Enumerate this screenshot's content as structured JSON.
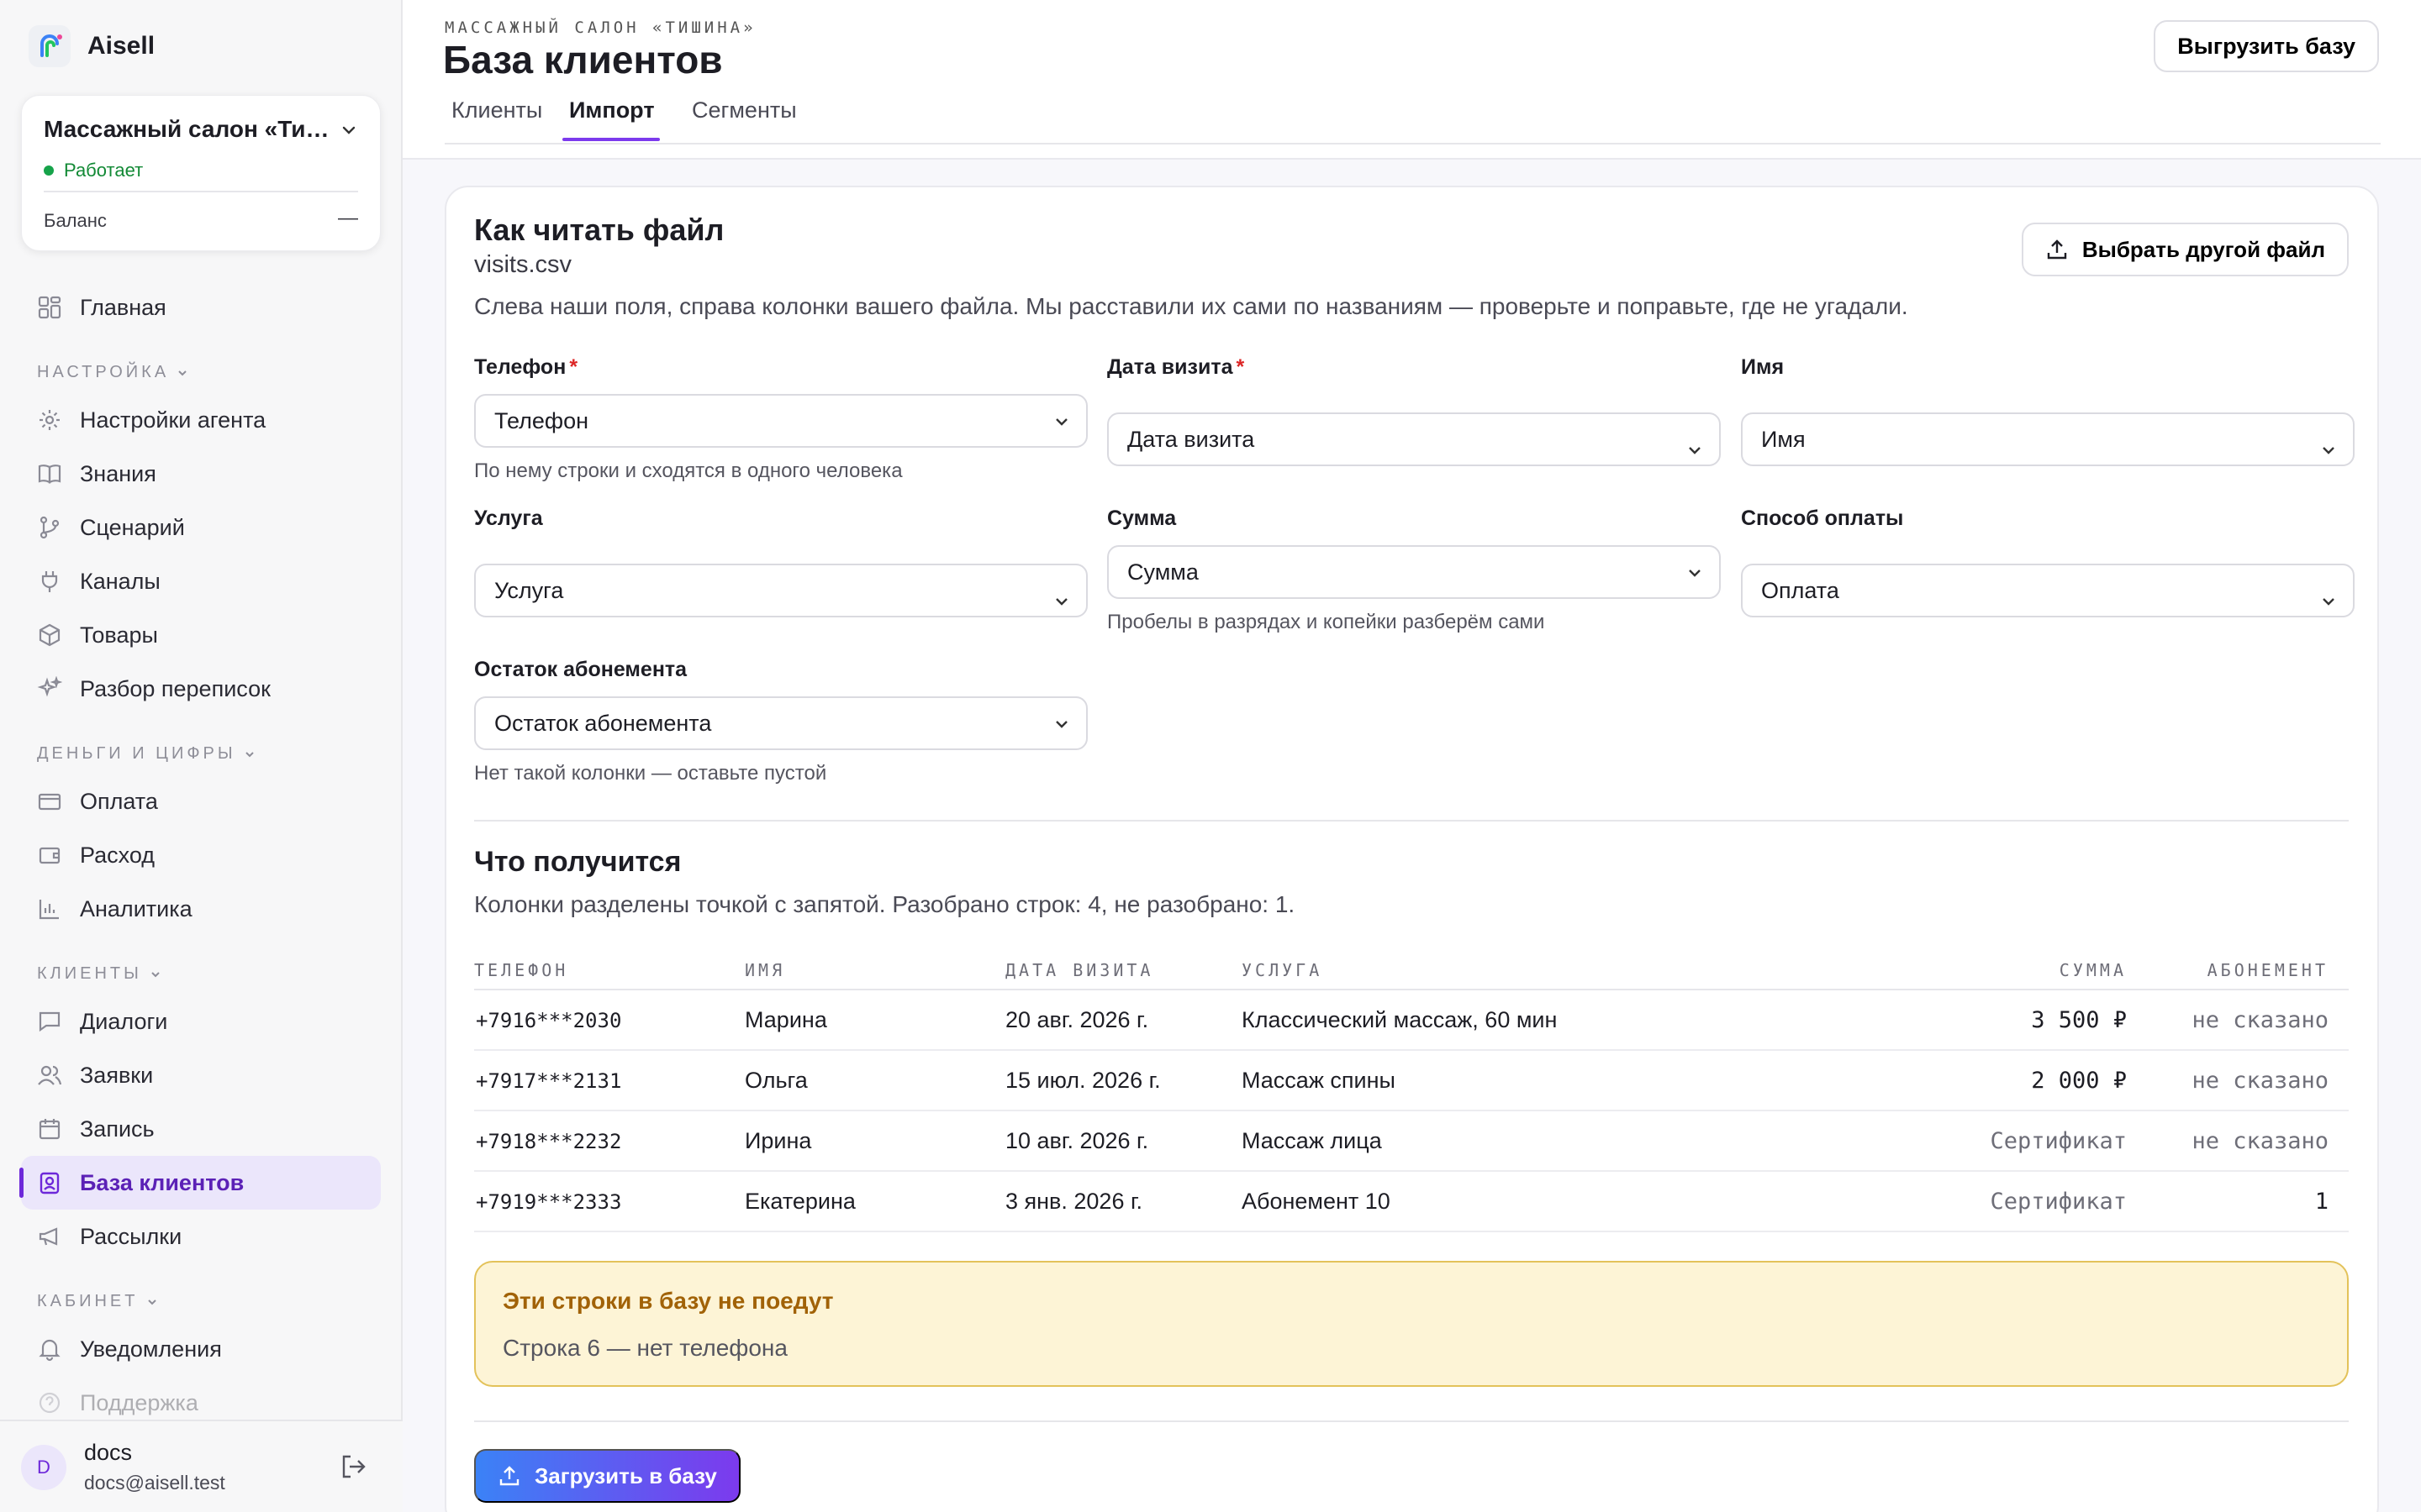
{
  "app": {
    "name": "Aisell"
  },
  "org": {
    "title": "Массажный салон «Тишина»",
    "status": "Работает",
    "balance_label": "Баланс",
    "balance_value": "—"
  },
  "nav": {
    "home": "Главная",
    "sections": {
      "settings": "НАСТРОЙКА",
      "money": "ДЕНЬГИ И ЦИФРЫ",
      "clients": "КЛИЕНТЫ",
      "cabinet": "КАБИНЕТ"
    },
    "agent_settings": "Настройки агента",
    "knowledge": "Знания",
    "scenario": "Сценарий",
    "channels": "Каналы",
    "goods": "Товары",
    "chat_review": "Разбор переписок",
    "payment": "Оплата",
    "expense": "Расход",
    "analytics": "Аналитика",
    "dialogs": "Диалоги",
    "requests": "Заявки",
    "booking": "Запись",
    "client_base": "База клиентов",
    "mailings": "Рассылки",
    "notifications": "Уведомления",
    "support": "Поддержка"
  },
  "user": {
    "initial": "D",
    "name": "docs",
    "email": "docs@aisell.test"
  },
  "header": {
    "overline": "МАССАЖНЫЙ САЛОН «ТИШИНА»",
    "title": "База клиентов",
    "export_label": "Выгрузить базу",
    "tabs": [
      "Клиенты",
      "Импорт",
      "Сегменты"
    ],
    "active_tab": "Импорт"
  },
  "mapping": {
    "title": "Как читать файл",
    "file_name": "visits.csv",
    "choose_file_label": "Выбрать другой файл",
    "hint": "Слева наши поля, справа колонки вашего файла. Мы расставили их сами по названиям — проверьте и поправьте, где не угадали.",
    "fields": {
      "phone": {
        "label": "Телефон",
        "required": "*",
        "value": "Телефон",
        "hint": "По нему строки и сходятся в одного человека"
      },
      "visit_date": {
        "label": "Дата визита",
        "required": "*",
        "value": "Дата визита"
      },
      "name": {
        "label": "Имя",
        "value": "Имя"
      },
      "service": {
        "label": "Услуга",
        "value": "Услуга"
      },
      "amount": {
        "label": "Сумма",
        "value": "Сумма",
        "hint": "Пробелы в разрядах и копейки разберём сами"
      },
      "payment_method": {
        "label": "Способ оплаты",
        "value": "Оплата"
      },
      "subscription_left": {
        "label": "Остаток абонемента",
        "value": "Остаток абонемента",
        "hint": "Нет такой колонки — оставьте пустой"
      }
    }
  },
  "preview": {
    "title": "Что получится",
    "summary": "Колонки разделены точкой с запятой. Разобрано строк: 4, не разобрано: 1.",
    "columns": {
      "phone": "ТЕЛЕФОН",
      "name": "ИМЯ",
      "date": "ДАТА ВИЗИТА",
      "service": "УСЛУГА",
      "amount": "СУММА",
      "subscription": "АБОНЕМЕНТ"
    },
    "rows": [
      {
        "phone": "+7916***2030",
        "name": "Марина",
        "date": "20 авг. 2026 г.",
        "service": "Классический массаж, 60 мин",
        "amount": "3 500 ₽",
        "subscription": "не сказано"
      },
      {
        "phone": "+7917***2131",
        "name": "Ольга",
        "date": "15 июл. 2026 г.",
        "service": "Массаж спины",
        "amount": "2 000 ₽",
        "subscription": "не сказано"
      },
      {
        "phone": "+7918***2232",
        "name": "Ирина",
        "date": "10 авг. 2026 г.",
        "service": "Массаж лица",
        "amount": "Сертификат",
        "subscription": "не сказано"
      },
      {
        "phone": "+7919***2333",
        "name": "Екатерина",
        "date": "3 янв. 2026 г.",
        "service": "Абонемент 10",
        "amount": "Сертификат",
        "subscription": "1"
      }
    ]
  },
  "rejected": {
    "title": "Эти строки в базу не поедут",
    "lines": [
      "Строка 6 — нет телефона"
    ]
  },
  "upload_label": "Загрузить в базу",
  "colors": {
    "accent": "#6d28d9",
    "success": "#16a34a",
    "warning_bg": "#fdf4d6",
    "warning_text": "#a16207"
  }
}
